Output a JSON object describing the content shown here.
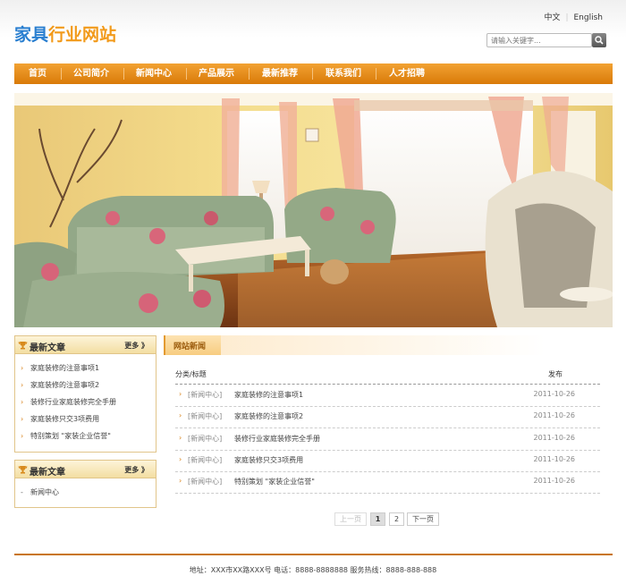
{
  "header": {
    "logo_part1": "家具",
    "logo_part2": "行业网站",
    "lang_cn": "中文",
    "lang_en": "English",
    "search_placeholder": "请输入关键字..."
  },
  "nav": {
    "items": [
      "首页",
      "公司简介",
      "新闻中心",
      "产品展示",
      "最新推荐",
      "联系我们",
      "人才招聘"
    ]
  },
  "sidebar": {
    "box1": {
      "title": "最新文章",
      "more": "更多 》",
      "items": [
        "家庭装修的注意事项1",
        "家庭装修的注意事项2",
        "装修行业家庭装修完全手册",
        "家庭装修只交3项费用",
        "特别策划 \"家装企业信誉\""
      ]
    },
    "box2": {
      "title": "最新文章",
      "more": "更多 》",
      "items": [
        "新闻中心"
      ]
    }
  },
  "news": {
    "tab_label": "网站新闻",
    "col_title": "分类/标题",
    "col_date": "发布",
    "rows": [
      {
        "category": "[新闻中心]",
        "title": "家庭装修的注意事项1",
        "date": "2011-10-26"
      },
      {
        "category": "[新闻中心]",
        "title": "家庭装修的注意事项2",
        "date": "2011-10-26"
      },
      {
        "category": "[新闻中心]",
        "title": "装修行业家庭装修完全手册",
        "date": "2011-10-26"
      },
      {
        "category": "[新闻中心]",
        "title": "家庭装修只交3项费用",
        "date": "2011-10-26"
      },
      {
        "category": "[新闻中心]",
        "title": "特别策划 \"家装企业信誉\"",
        "date": "2011-10-26"
      }
    ]
  },
  "pager": {
    "prev": "上一页",
    "page1": "1",
    "page2": "2",
    "next": "下一页"
  },
  "footer": {
    "text": "地址：XXX市XX路XXX号 电话：8888-8888888 服务热线：8888-888-888"
  },
  "colors": {
    "nav_orange": "#e8900f",
    "logo_blue": "#2a7fd0",
    "logo_orange": "#f29a1a"
  }
}
